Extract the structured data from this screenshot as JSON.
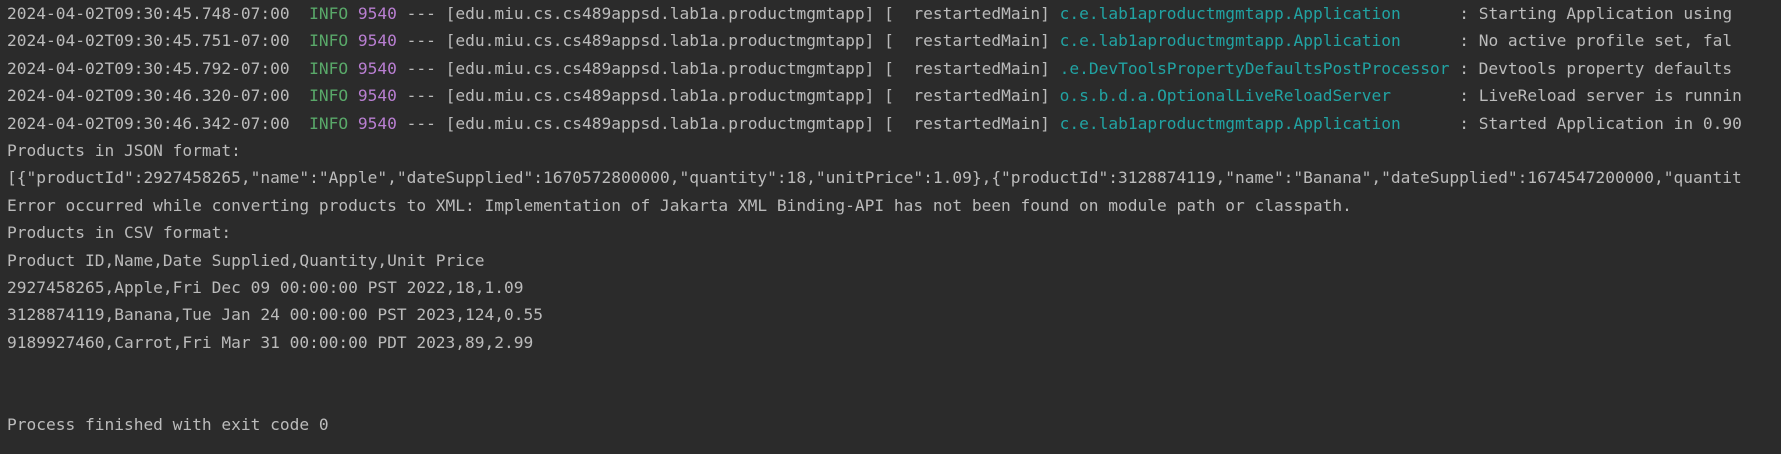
{
  "colors": {
    "background": "#2b2b2b",
    "text": "#bbbbbb",
    "info_level": "#59a869",
    "pid": "#b97fd2",
    "logger": "#21a3a3"
  },
  "log_lines": [
    {
      "timestamp": "2024-04-02T09:30:45.748-07:00",
      "level": "INFO",
      "pid": "9540",
      "sep": "---",
      "app": "[edu.miu.cs.cs489appsd.lab1a.productmgmtapp]",
      "thread": "[  restartedMain]",
      "logger": "c.e.lab1aproductmgmtapp.Application",
      "message": ": Starting Application using"
    },
    {
      "timestamp": "2024-04-02T09:30:45.751-07:00",
      "level": "INFO",
      "pid": "9540",
      "sep": "---",
      "app": "[edu.miu.cs.cs489appsd.lab1a.productmgmtapp]",
      "thread": "[  restartedMain]",
      "logger": "c.e.lab1aproductmgmtapp.Application",
      "message": ": No active profile set, fal"
    },
    {
      "timestamp": "2024-04-02T09:30:45.792-07:00",
      "level": "INFO",
      "pid": "9540",
      "sep": "---",
      "app": "[edu.miu.cs.cs489appsd.lab1a.productmgmtapp]",
      "thread": "[  restartedMain]",
      "logger": ".e.DevToolsPropertyDefaultsPostProcessor",
      "message": ": Devtools property defaults"
    },
    {
      "timestamp": "2024-04-02T09:30:46.320-07:00",
      "level": "INFO",
      "pid": "9540",
      "sep": "---",
      "app": "[edu.miu.cs.cs489appsd.lab1a.productmgmtapp]",
      "thread": "[  restartedMain]",
      "logger": "o.s.b.d.a.OptionalLiveReloadServer",
      "message": ": LiveReload server is runnin"
    },
    {
      "timestamp": "2024-04-02T09:30:46.342-07:00",
      "level": "INFO",
      "pid": "9540",
      "sep": "---",
      "app": "[edu.miu.cs.cs489appsd.lab1a.productmgmtapp]",
      "thread": "[  restartedMain]",
      "logger": "c.e.lab1aproductmgmtapp.Application",
      "message": ": Started Application in 0.90"
    }
  ],
  "output": {
    "json_header": "Products in JSON format:",
    "json_body": "[{\"productId\":2927458265,\"name\":\"Apple\",\"dateSupplied\":1670572800000,\"quantity\":18,\"unitPrice\":1.09},{\"productId\":3128874119,\"name\":\"Banana\",\"dateSupplied\":1674547200000,\"quantit",
    "xml_error": "Error occurred while converting products to XML: Implementation of Jakarta XML Binding-API has not been found on module path or classpath.",
    "csv_header": "Products in CSV format:",
    "csv_rows": [
      "Product ID,Name,Date Supplied,Quantity,Unit Price",
      "2927458265,Apple,Fri Dec 09 00:00:00 PST 2022,18,1.09",
      "3128874119,Banana,Tue Jan 24 00:00:00 PST 2023,124,0.55",
      "9189927460,Carrot,Fri Mar 31 00:00:00 PDT 2023,89,2.99"
    ],
    "exit_message": "Process finished with exit code 0"
  }
}
